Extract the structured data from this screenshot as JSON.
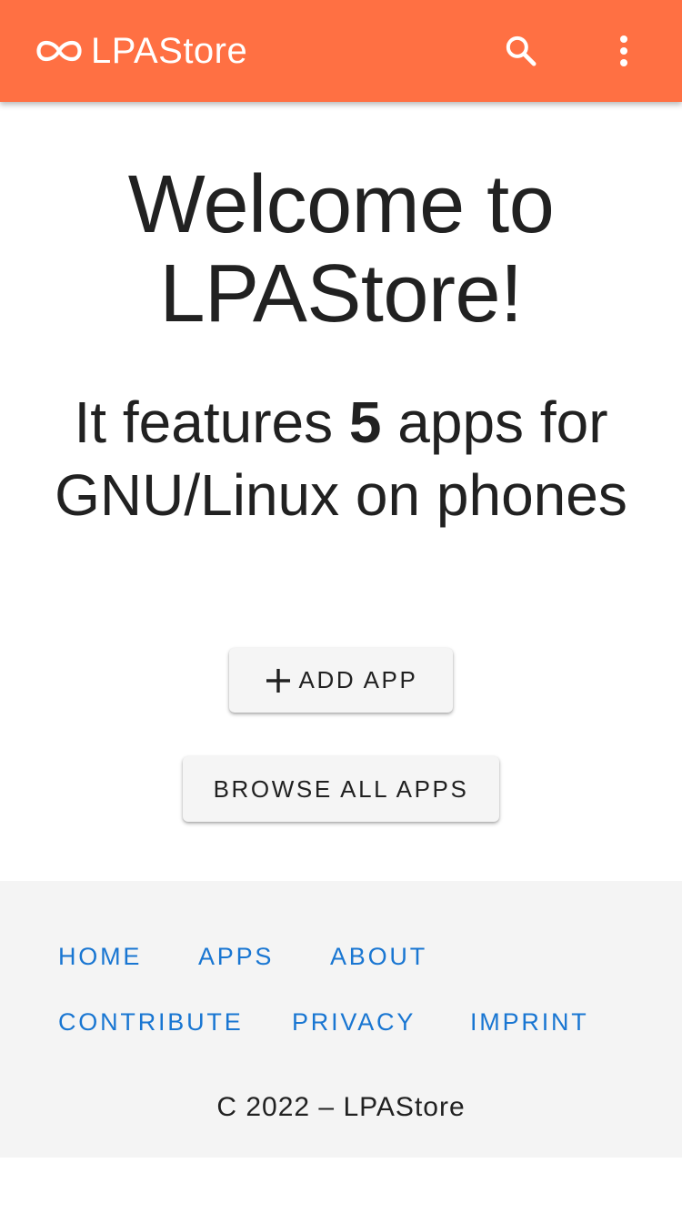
{
  "app_bar": {
    "title": "LPAStore",
    "logo_icon": "infinity-icon",
    "search_icon": "search-icon",
    "menu_icon": "more-vertical-icon",
    "color": "#ff7043"
  },
  "main": {
    "welcome_line1": "Welcome to",
    "welcome_line2": "LPAStore!",
    "subtitle_prefix": "It features",
    "app_count": "5",
    "subtitle_suffix": "apps for GNU/Linux on phones",
    "add_app_label": "ADD APP",
    "add_app_icon": "plus-icon",
    "browse_label": "BROWSE ALL APPS"
  },
  "footer": {
    "links": [
      "HOME",
      "APPS",
      "ABOUT",
      "CONTRIBUTE",
      "PRIVACY",
      "IMPRINT"
    ],
    "copyright": "C 2022 – LPAStore",
    "link_color": "#1976d2",
    "background": "#f4f4f4"
  }
}
